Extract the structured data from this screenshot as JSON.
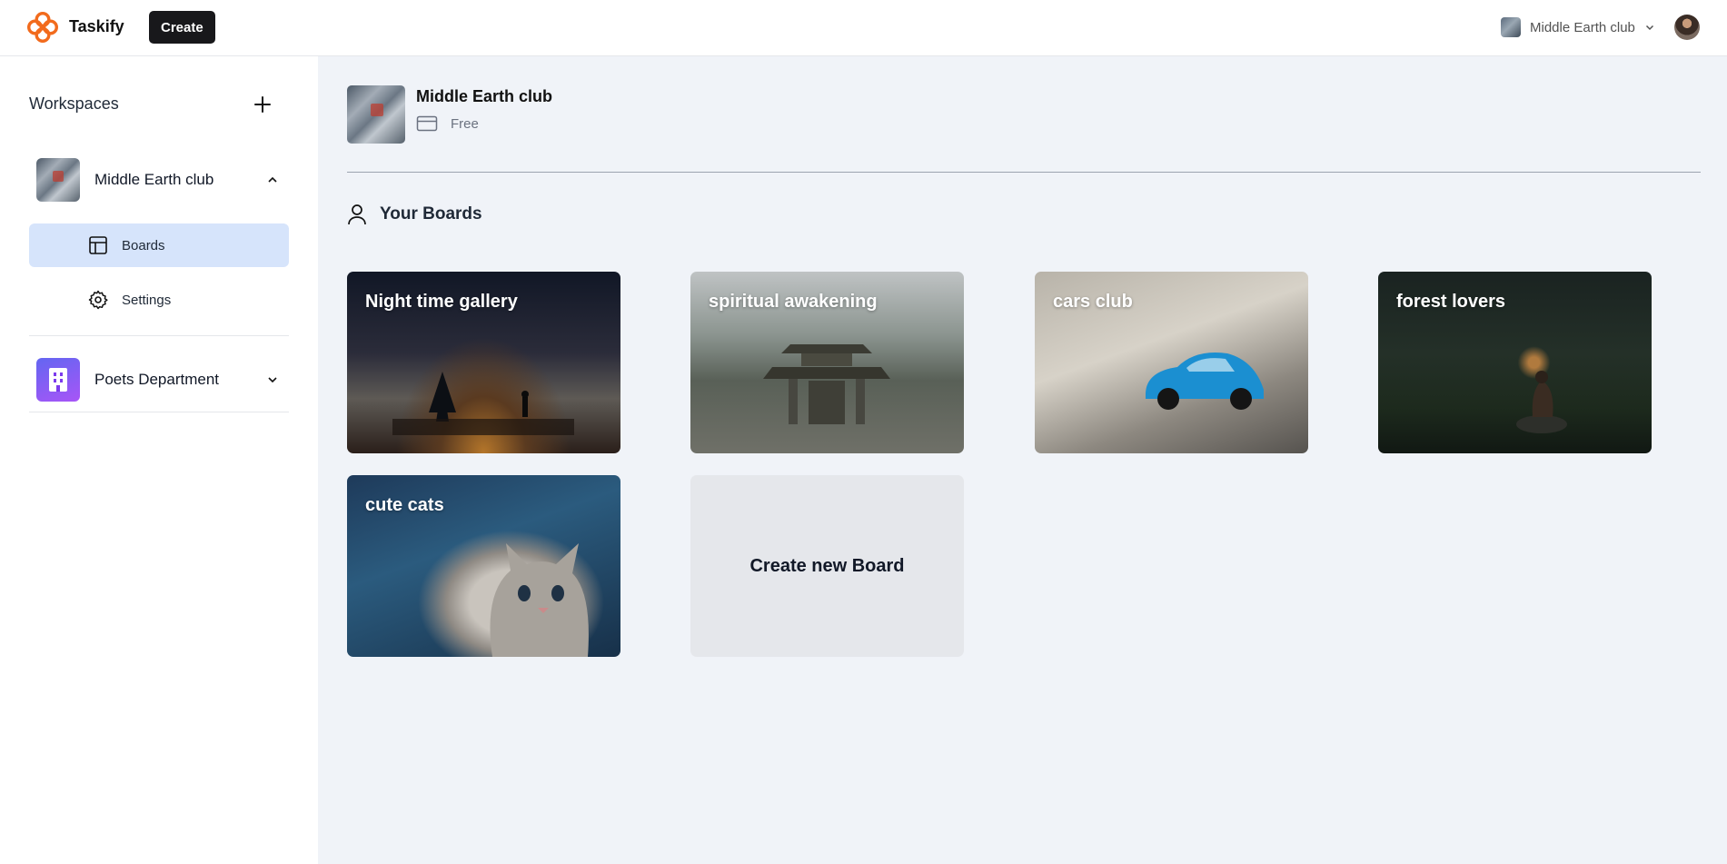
{
  "navbar": {
    "brand": "Taskify",
    "create_label": "Create",
    "org_switcher_label": "Middle Earth club"
  },
  "sidebar": {
    "title": "Workspaces",
    "workspaces": [
      {
        "name": "Middle Earth club",
        "expanded": true
      },
      {
        "name": "Poets Department",
        "expanded": false
      }
    ],
    "sub_items": [
      {
        "label": "Boards",
        "icon": "layout-icon",
        "active": true
      },
      {
        "label": "Settings",
        "icon": "gear-icon",
        "active": false
      }
    ]
  },
  "main": {
    "org_name": "Middle Earth club",
    "plan": "Free",
    "section_title": "Your Boards",
    "boards": [
      {
        "title": "Night time gallery"
      },
      {
        "title": "spiritual awakening"
      },
      {
        "title": "cars club"
      },
      {
        "title": "forest lovers"
      },
      {
        "title": "cute cats"
      }
    ],
    "create_board_label": "Create new Board"
  },
  "colors": {
    "accent_orange": "#f26b1d",
    "active_item_bg": "#d6e4fb",
    "main_bg": "#f0f3f8",
    "poets_avatar": "#7c3aed"
  }
}
